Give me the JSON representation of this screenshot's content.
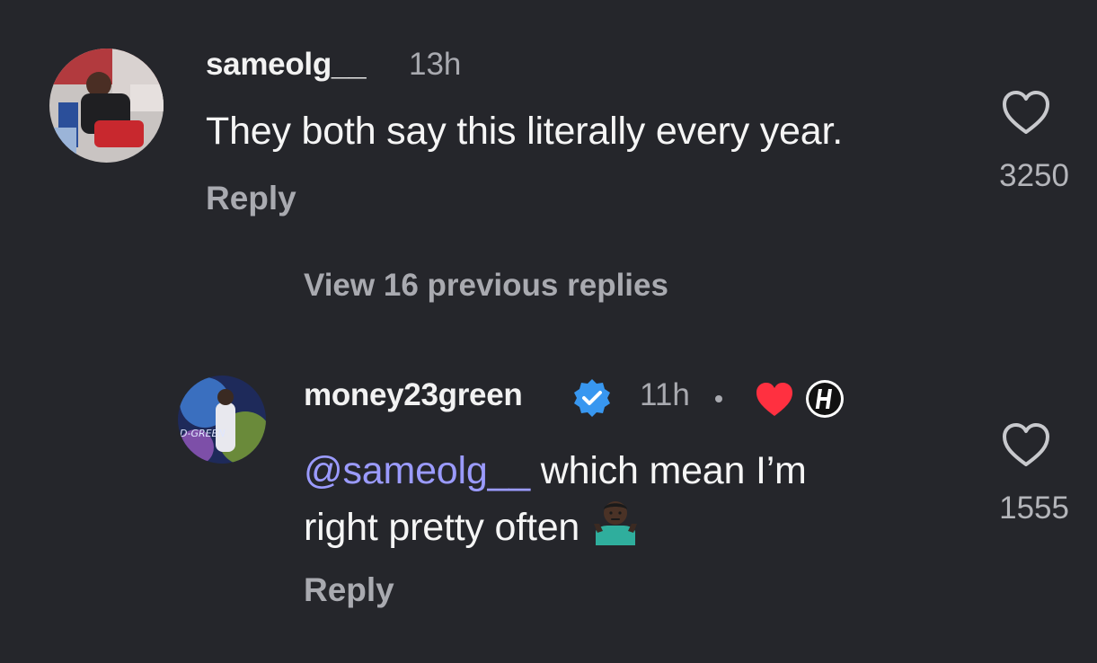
{
  "comments": [
    {
      "username": "sameolg__",
      "time": "13h",
      "text": "They both say this literally every year.",
      "reply_label": "Reply",
      "likes": "3250",
      "avatar_icon": "basketball-player-avatar"
    }
  ],
  "view_replies_label": "View 16 previous replies",
  "reply": {
    "username": "money23green",
    "verified": true,
    "time": "11h",
    "separator": "•",
    "mention": "@sameolg__",
    "text_line1": " which mean I’m",
    "text_line2": "right pretty often",
    "emoji": "person-shrugging-emoji",
    "reply_label": "Reply",
    "likes": "1555",
    "avatar_icon": "basketball-player-avatar"
  },
  "colors": {
    "background": "#25262b",
    "mention": "#9b9bff",
    "verified": "#3897f0",
    "creator_heart": "#ff3040",
    "muted_text": "#a9aab0"
  }
}
